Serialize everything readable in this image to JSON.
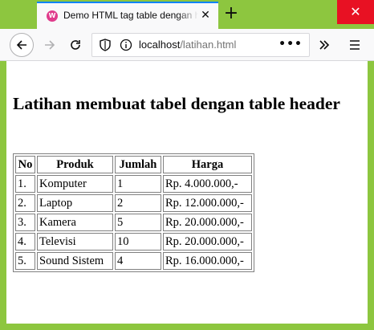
{
  "browser": {
    "tab_title": "Demo HTML tag table dengan header",
    "favicon_letter": "W",
    "new_tab_symbol": "+",
    "close_symbol": "✕",
    "url_host": "localhost",
    "url_path": "/latihan.html",
    "page_actions": "•••"
  },
  "page": {
    "heading": "Latihan membuat tabel dengan table header",
    "table": {
      "headers": [
        "No",
        "Produk",
        "Jumlah",
        "Harga"
      ],
      "rows": [
        [
          "1.",
          "Komputer",
          "1",
          "Rp. 4.000.000,-"
        ],
        [
          "2.",
          "Laptop",
          "2",
          "Rp. 12.000.000,-"
        ],
        [
          "3.",
          "Kamera",
          "5",
          "Rp. 20.000.000,-"
        ],
        [
          "4.",
          "Televisi",
          "10",
          "Rp. 20.000.000,-"
        ],
        [
          "5.",
          "Sound Sistem",
          "4",
          "Rp. 16.000.000,-"
        ]
      ]
    }
  },
  "colors": {
    "frame": "#8dc63f",
    "window_close": "#e81123",
    "tab_accent": "#0a84ff"
  }
}
